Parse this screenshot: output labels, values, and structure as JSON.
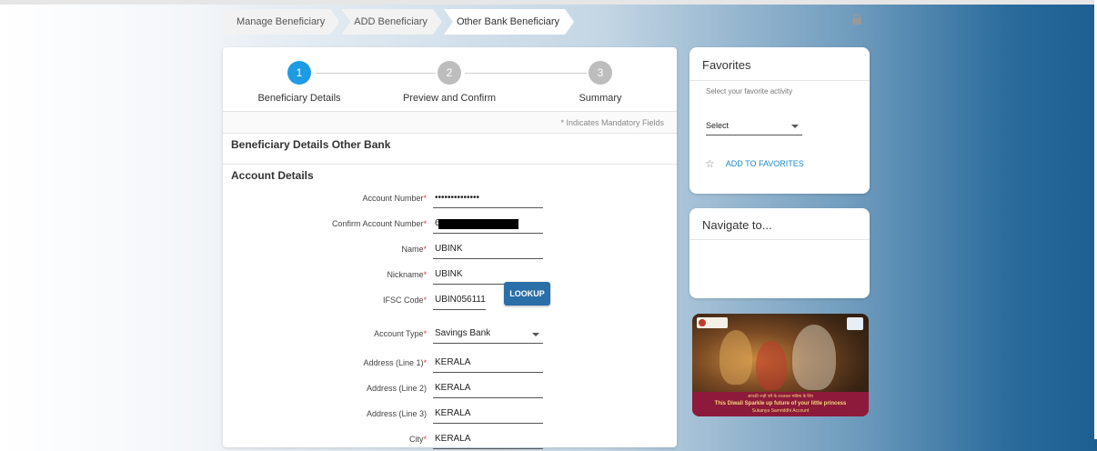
{
  "breadcrumb": [
    "Manage Beneficiary",
    "ADD Beneficiary",
    "Other Bank Beneficiary"
  ],
  "stepper": {
    "steps": [
      {
        "num": "1",
        "label": "Beneficiary Details"
      },
      {
        "num": "2",
        "label": "Preview and Confirm"
      },
      {
        "num": "3",
        "label": "Summary"
      }
    ],
    "active_step": 1
  },
  "form": {
    "mandatory_note": "* Indicates Mandatory Fields",
    "section_title": "Beneficiary Details Other Bank",
    "subsection_title": "Account Details",
    "lookup_label": "LOOKUP",
    "required_mark": "*",
    "fields": [
      {
        "label": "Account Number",
        "value": "••••••••••••••",
        "required": true
      },
      {
        "label": "Confirm Account Number",
        "value": "6",
        "required": true
      },
      {
        "label": "Name",
        "value": "UBINK",
        "required": true
      },
      {
        "label": "Nickname",
        "value": "UBINK",
        "required": true
      },
      {
        "label": "IFSC Code",
        "value": "UBIN056111",
        "required": true
      },
      {
        "label": "Account Type",
        "value": "Savings Bank",
        "required": true
      },
      {
        "label": "Address (Line 1)",
        "value": "KERALA",
        "required": true
      },
      {
        "label": "Address (Line 2)",
        "value": "KERALA",
        "required": false
      },
      {
        "label": "Address (Line 3)",
        "value": "KERALA",
        "required": false
      },
      {
        "label": "City",
        "value": "KERALA",
        "required": true
      }
    ]
  },
  "favorites": {
    "title": "Favorites",
    "subtitle": "Select your favorite activity",
    "select_value": "Select",
    "add_label": "ADD TO FAVORITES"
  },
  "navigate": {
    "title": "Navigate to..."
  },
  "banner": {
    "line1": "आपकी नन्ही परी के उज्जवल भविष्य के लिए",
    "line2": "This Diwali Sparkle up future of your little princess",
    "line3": "Sukanya Samriddhi Account"
  },
  "colors": {
    "accent": "#1e9be4",
    "button": "#2a6fa8",
    "required": "#e53935",
    "link": "#1e88c8"
  }
}
